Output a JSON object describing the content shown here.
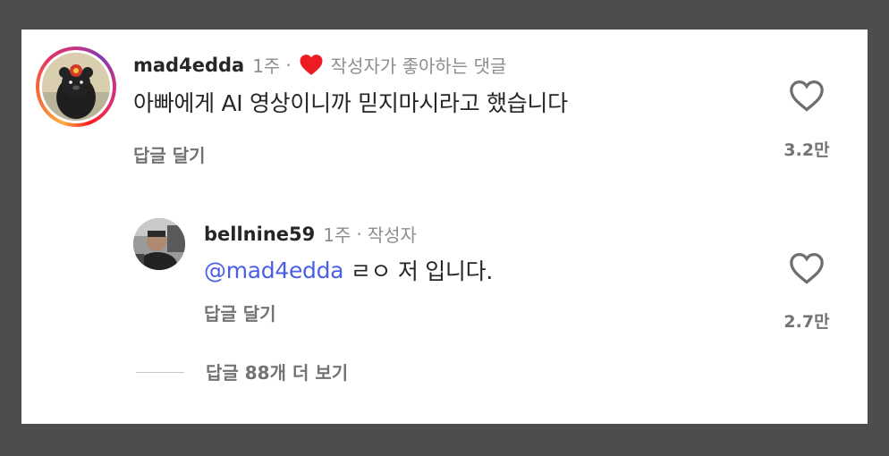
{
  "comment": {
    "username": "mad4edda",
    "time": "1주",
    "separator": "·",
    "author_liked_label": "작성자가 좋아하는 댓글",
    "text": "아빠에게 AI 영상이니까 믿지마시라고 했습니다",
    "reply_link": "답글 달기",
    "like_count": "3.2만"
  },
  "reply": {
    "username": "bellnine59",
    "time": "1주",
    "separator": "·",
    "author_badge": "작성자",
    "mention": "@mad4edda",
    "text": " ㄹㅇ 저 입니다.",
    "reply_link": "답글 달기",
    "like_count": "2.7만"
  },
  "view_more_replies": "답글 88개 더 보기",
  "colors": {
    "heart_red": "#ed1c24",
    "mention_blue": "#4a5ee8",
    "background": "#4d4d4d"
  }
}
